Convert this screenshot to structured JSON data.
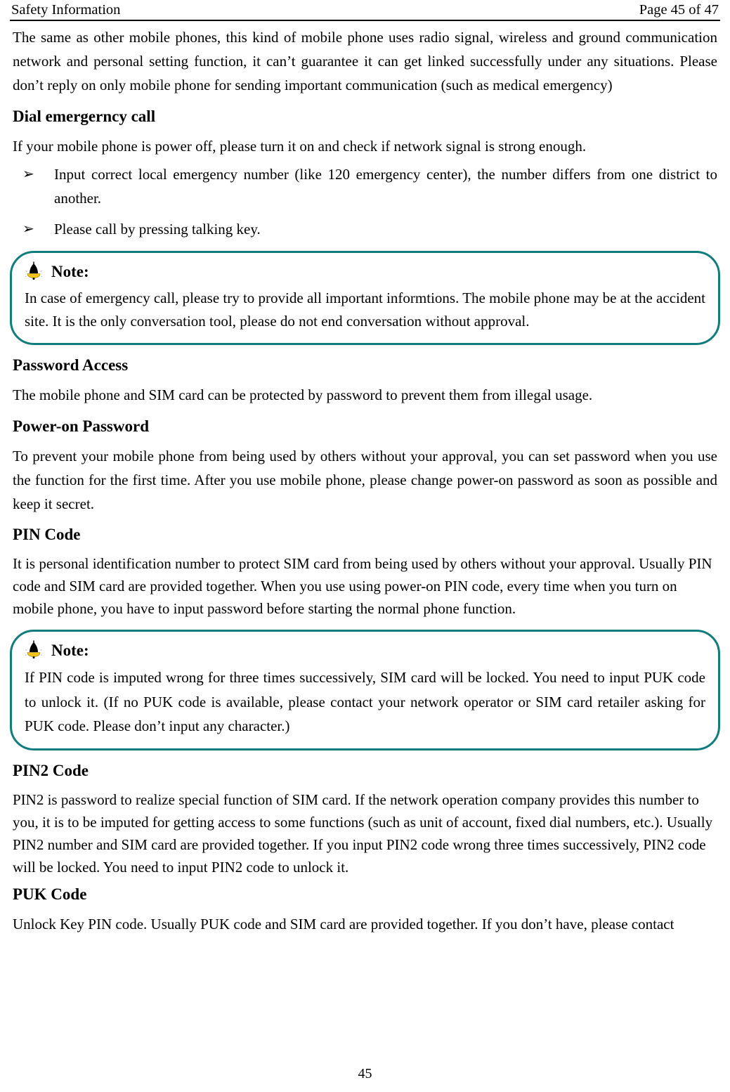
{
  "header": {
    "left_title": "Safety Information",
    "right_page_label": "Page 45 of 47"
  },
  "colors": {
    "note_border": "#127C7C",
    "bell_body": "#000000",
    "bell_base": "#F2C318",
    "text": "#000000"
  },
  "content": {
    "intro_paragraph": "The same as other mobile phones, this kind of mobile phone uses radio signal, wireless and ground communication network and personal setting function, it can’t guarantee it can get linked successfully under any situations. Please don’t reply on only mobile phone for sending important communication (such as medical emergency)",
    "dial_heading": "Dial emergerncy call",
    "dial_intro": "If your mobile phone is power off, please turn it on and check if network signal is strong enough.",
    "dial_bullets": [
      {
        "marker": "➢",
        "text": "Input correct local emergency number (like 120 emergency center), the number differs from one district to another."
      },
      {
        "marker": "➢",
        "text": "Please call by pressing talking key."
      }
    ],
    "note_1": {
      "icon": "bell-icon",
      "title": "Note:",
      "body": "In case of emergency call, please try to provide all important informtions. The mobile phone may be at the accident site. It is the only conversation tool, please do not end conversation without approval."
    },
    "password_access_heading": "Password Access",
    "password_access_paragraph": "The mobile phone and SIM card can be protected by password to prevent them from illegal usage.",
    "power_on_heading": "Power-on Password",
    "power_on_paragraph": "To prevent your mobile phone from being used by others without your approval, you can set password when you use the function for the first time. After you use mobile phone, please change power-on password as soon as possible and keep it secret.",
    "pin_code_heading": "PIN Code",
    "pin_code_paragraph": "It is personal identification number to protect SIM card from being used by others without your approval. Usually PIN code and SIM card are provided together. When you use using power-on PIN code, every time when you turn on mobile phone, you have to input password before starting the normal phone function.",
    "note_2": {
      "icon": "bell-icon",
      "title": "Note:",
      "body": "If PIN code is imputed wrong for three times successively, SIM card will be locked. You need to input PUK code to unlock it. (If no PUK code is available, please contact your network operator or SIM card retailer asking for PUK code. Please don’t input any character.)"
    },
    "pin2_heading": "PIN2 Code",
    "pin2_paragraph": "PIN2 is password to realize special function of SIM card. If the network operation company provides this number to you, it is to be imputed for getting access to some functions (such as unit of account, fixed dial numbers, etc.). Usually PIN2 number and SIM card are provided together. If you input PIN2 code wrong three times successively, PIN2 code will be locked. You need to input PIN2 code to unlock it.",
    "puk_heading": "PUK Code",
    "puk_paragraph": "Unlock Key PIN code. Usually PUK code and SIM card are provided together. If you don’t have, please contact"
  },
  "footer": {
    "page_number": "45"
  }
}
